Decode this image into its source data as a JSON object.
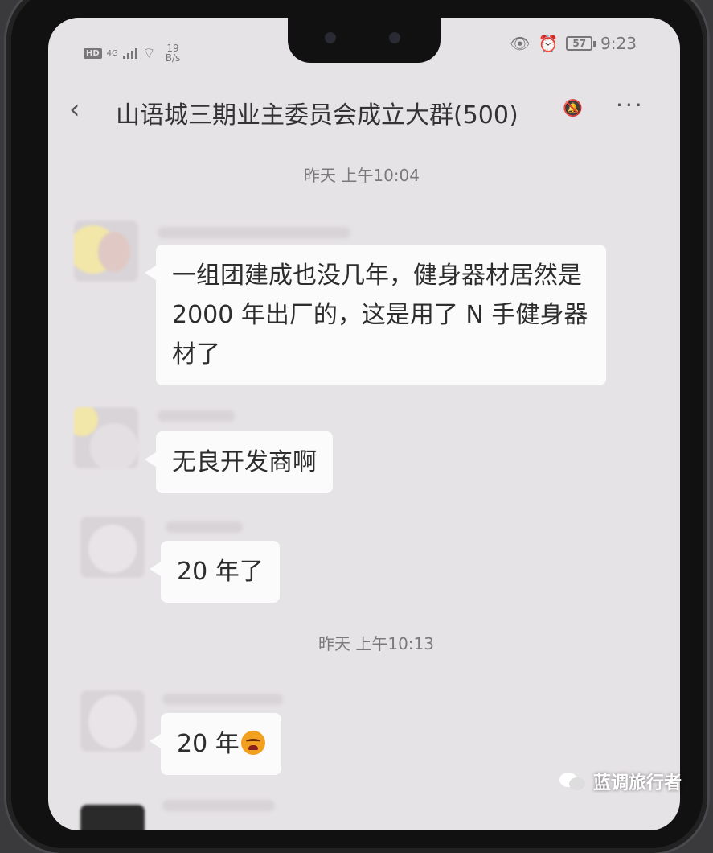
{
  "status_bar": {
    "hd": "HD",
    "network": "4G",
    "speed_value": "19",
    "speed_unit": "B/s",
    "battery": "57",
    "time": "9:23"
  },
  "chat": {
    "title": "山语城三期业主委员会成立大群(500)"
  },
  "timestamps": [
    "昨天 上午10:04",
    "昨天 上午10:13"
  ],
  "messages": [
    "一组团建成也没几年，健身器材居然是 2000 年出厂的，这是用了 N 手健身器材了",
    "无良开发商啊",
    "20 年了",
    "20 年"
  ],
  "icons": {
    "back": "chevron-left-icon",
    "mute": "bell-off-icon",
    "more": "more-dots-icon",
    "eye": "eye-icon",
    "alarm": "alarm-icon",
    "angry": "angry-emoji-icon"
  },
  "watermark": "蓝调旅行者",
  "colors": {
    "screen_bg": "#e6e3e6",
    "bubble_bg": "#fbfbfb",
    "text": "#2d2d2d"
  }
}
